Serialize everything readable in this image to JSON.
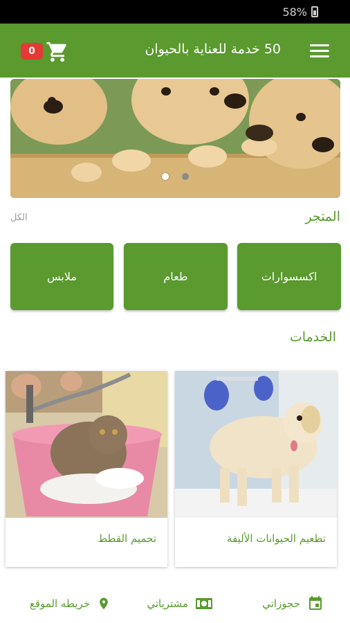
{
  "status_bar": {
    "battery": "58%"
  },
  "app_bar": {
    "title": "50 خدمة للعناية بالحيوان",
    "cart_count": "0"
  },
  "store": {
    "title": "المتجر",
    "see_all": "الكل",
    "categories": [
      "اكسسوارات",
      "طعام",
      "ملابس"
    ]
  },
  "services": {
    "title": "الخدمات",
    "items": [
      {
        "label": "تطعيم الحيوانات الأليفة"
      },
      {
        "label": "تحميم القطط"
      }
    ]
  },
  "bottom_nav": {
    "items": [
      {
        "label": "حجوزاتي",
        "icon": "calendar-icon"
      },
      {
        "label": "مشترياتي",
        "icon": "money-icon"
      },
      {
        "label": "خريطه الموقع",
        "icon": "location-pin-icon"
      }
    ]
  },
  "colors": {
    "primary": "#5a9a2e",
    "badge": "#e53935"
  }
}
